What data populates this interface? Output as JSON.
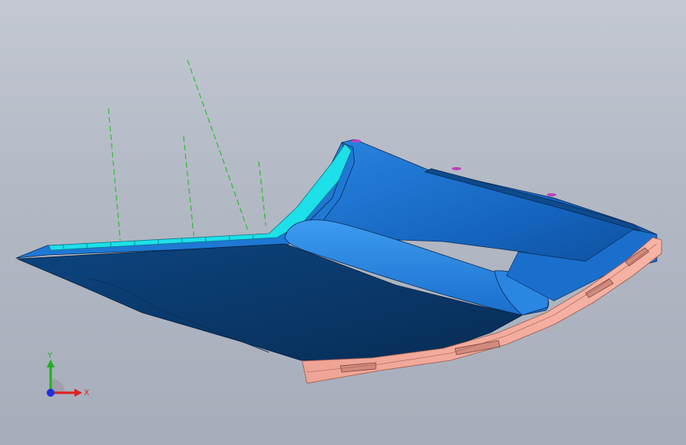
{
  "view": {
    "background_top": "#c3c8d2",
    "background_bottom": "#a7aebb"
  },
  "model": {
    "body_color": "#1565c0",
    "inner_panel_color": "#0a3a6a",
    "channel_color": "#1ee0e8",
    "trim_color": "#f0a090",
    "construction_line_color": "#22c022"
  },
  "triad": {
    "x_label": "X",
    "y_label": "Y",
    "x_color": "#e02020",
    "y_color": "#20b020",
    "z_color": "#2030e0"
  }
}
